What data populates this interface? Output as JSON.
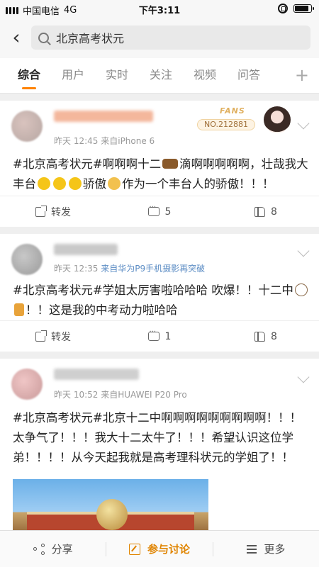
{
  "status_bar": {
    "carrier": "中国电信",
    "network": "4G",
    "time": "下午3:11"
  },
  "search": {
    "query": "北京高考状元"
  },
  "tabs": [
    {
      "label": "综合"
    },
    {
      "label": "用户"
    },
    {
      "label": "实时"
    },
    {
      "label": "关注"
    },
    {
      "label": "视频"
    },
    {
      "label": "问答"
    }
  ],
  "tab_add": "+",
  "posts": [
    {
      "time": "昨天 12:45",
      "source": "来自iPhone 6",
      "fans_label": "FANS",
      "fans_no": "NO.212881",
      "text_a": "#北京高考状元#啊啊啊十二",
      "text_b": "滴啊啊啊啊啊，壮哉我大丰台",
      "text_c": "骄傲",
      "text_d": "作为一个丰台人的骄傲！！！",
      "repost": "转发",
      "comments": "5",
      "likes": "8"
    },
    {
      "time": "昨天 12:35",
      "source": "来自华为P9手机摄影再突破",
      "text_a": "#北京高考状元#学姐太厉害啦哈哈哈 吹爆！！十二中",
      "text_b": "！！这是我的中考动力啦哈哈",
      "repost": "转发",
      "comments": "1",
      "likes": "8"
    },
    {
      "time": "昨天 10:52",
      "source": "来自HUAWEI P20 Pro",
      "text": "#北京高考状元#北京十二中啊啊啊啊啊啊啊啊啊！！！太争气了！！！我大十二太牛了！！！希望认识这位学弟！！！！从今天起我就是高考理科状元的学姐了！！"
    }
  ],
  "bottom_bar": {
    "share": "分享",
    "discuss": "参与讨论",
    "more": "更多"
  },
  "colors": {
    "accent": "#ff8200",
    "source_blue": "#5b8cc4"
  }
}
